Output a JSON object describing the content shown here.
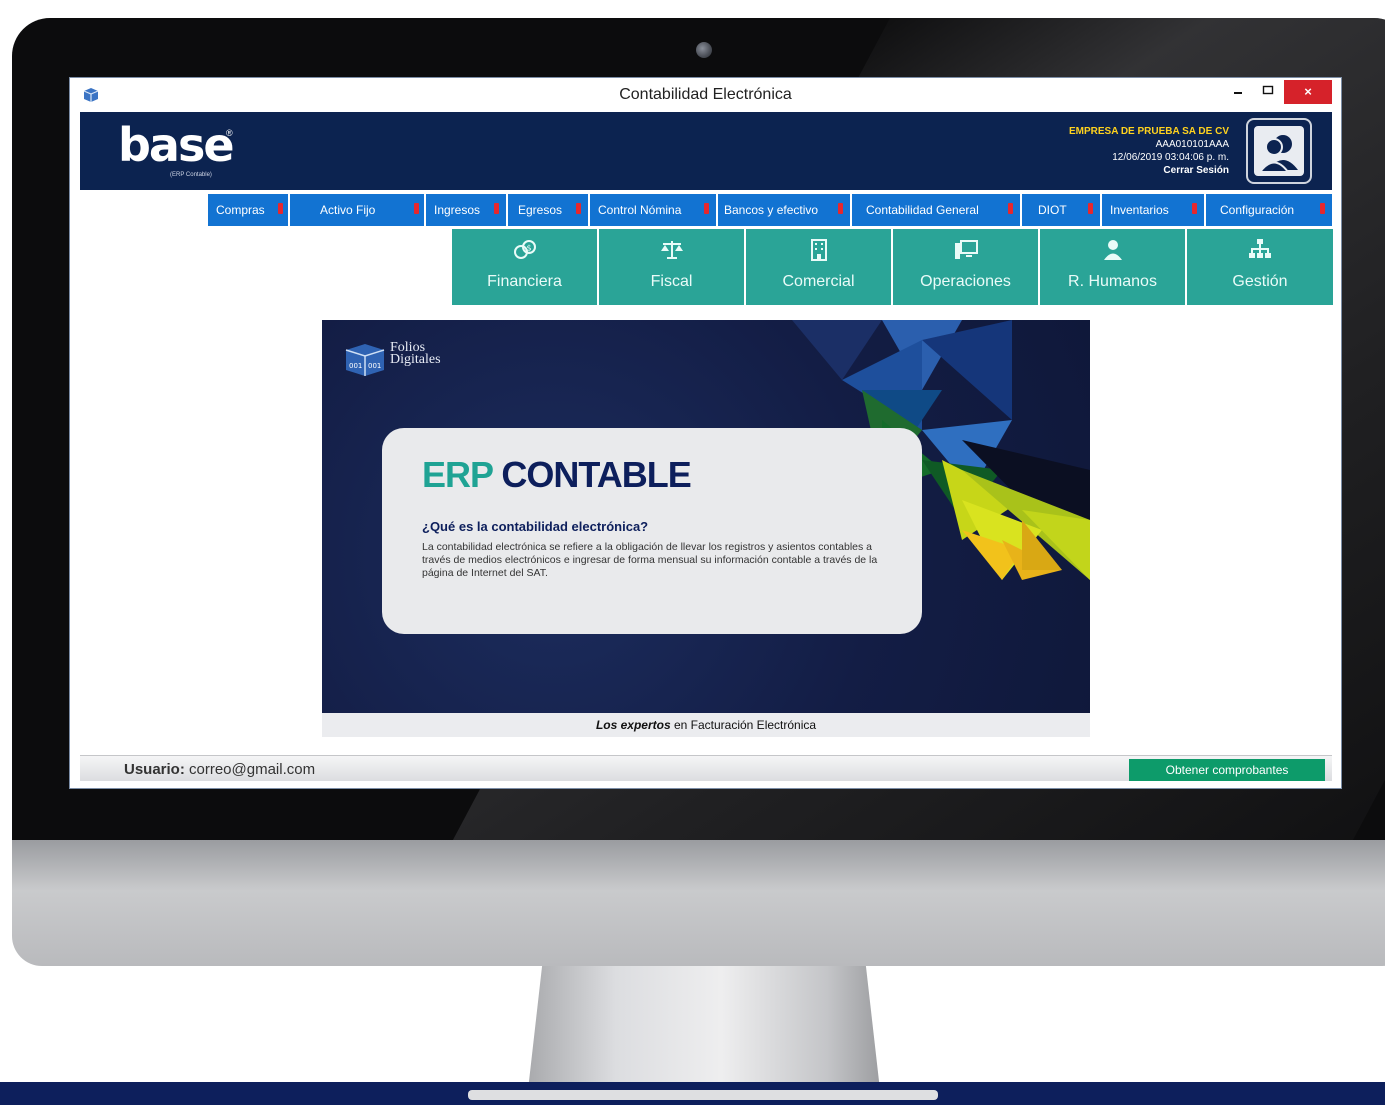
{
  "window": {
    "title": "Contabilidad Electrónica",
    "close_symbol": "×"
  },
  "header": {
    "logo_text": "base",
    "logo_reg": "®",
    "logo_sub": "(ERP Contable)",
    "company_name": "EMPRESA DE PRUEBA SA DE CV",
    "rfc": "AAA010101AAA",
    "datetime": "12/06/2019 03:04:06 p. m.",
    "logout_label": "Cerrar Sesión"
  },
  "menu": [
    {
      "label": "Compras"
    },
    {
      "label": "Activo Fijo"
    },
    {
      "label": "Ingresos"
    },
    {
      "label": "Egresos"
    },
    {
      "label": "Control Nómina"
    },
    {
      "label": "Bancos y efectivo"
    },
    {
      "label": "Contabilidad General"
    },
    {
      "label": "DIOT"
    },
    {
      "label": "Inventarios"
    },
    {
      "label": "Configuración"
    }
  ],
  "modules": [
    {
      "label": "Financiera",
      "icon": "coins-icon"
    },
    {
      "label": "Fiscal",
      "icon": "scale-icon"
    },
    {
      "label": "Comercial",
      "icon": "building-icon"
    },
    {
      "label": "Operaciones",
      "icon": "workstation-icon"
    },
    {
      "label": "R. Humanos",
      "icon": "person-icon"
    },
    {
      "label": "Gestión",
      "icon": "org-chart-icon"
    }
  ],
  "banner": {
    "brand_line1": "Folios",
    "brand_line2": "Digitales",
    "title_erp": "ERP",
    "title_contable": "CONTABLE",
    "question": "¿Qué es la contabilidad electrónica?",
    "body": "La contabilidad electrónica se refiere a la obligación de llevar los registros y asientos contables a través de medios electrónicos e ingresar de forma mensual su información contable a través de la página de Internet del SAT.",
    "footer_bold": "Los expertos",
    "footer_rest": " en Facturación Electrónica"
  },
  "status": {
    "user_label": "Usuario:",
    "user_email": " correo@gmail.com",
    "fetch_button": "Obtener comprobantes"
  },
  "colors": {
    "header_bg": "#0c2350",
    "menu_bg": "#1273d2",
    "module_bg": "#2aa497",
    "accent_yellow": "#ffd21e",
    "close_red": "#d6222a",
    "fetch_green": "#0d9b6a"
  }
}
